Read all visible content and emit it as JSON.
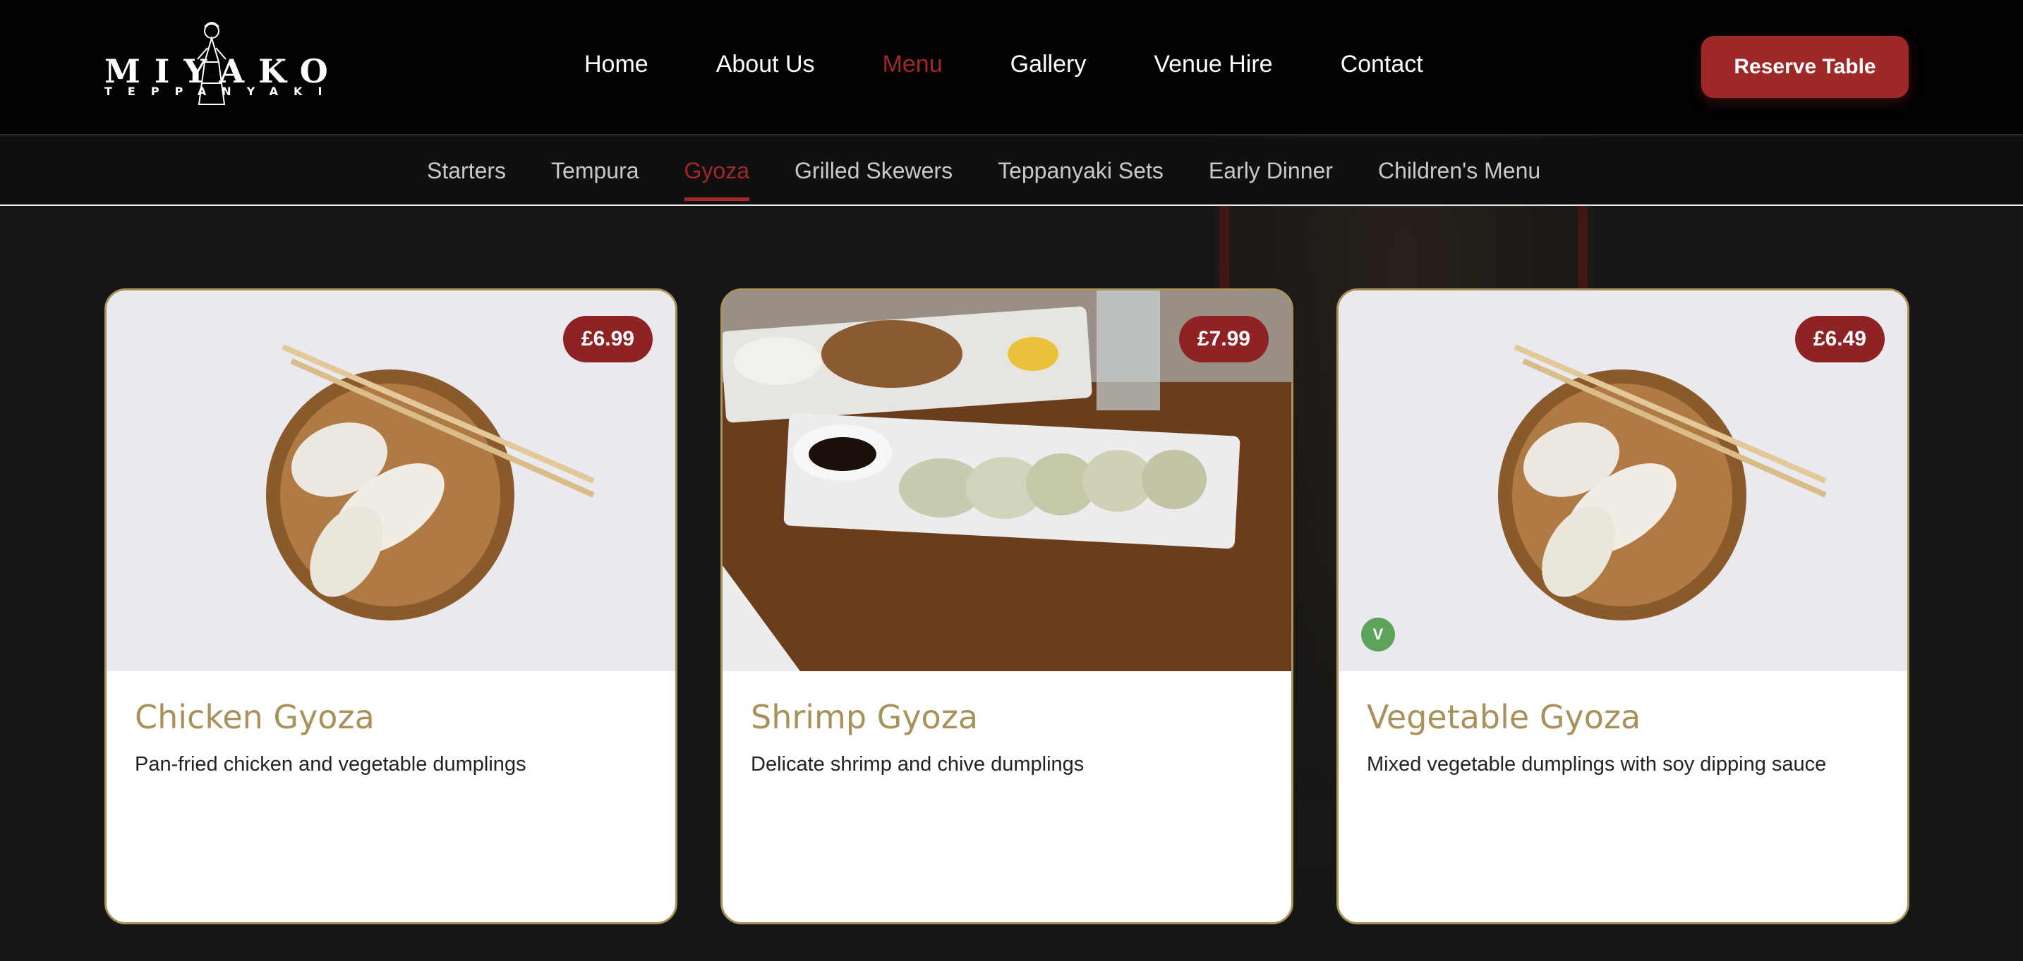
{
  "brand": {
    "name": "MIYAKO",
    "subtitle": "TEPPANYAKI"
  },
  "nav": {
    "items": [
      {
        "label": "Home",
        "active": false
      },
      {
        "label": "About Us",
        "active": false
      },
      {
        "label": "Menu",
        "active": true
      },
      {
        "label": "Gallery",
        "active": false
      },
      {
        "label": "Venue Hire",
        "active": false
      },
      {
        "label": "Contact",
        "active": false
      }
    ],
    "reserve_label": "Reserve Table"
  },
  "subnav": {
    "items": [
      {
        "label": "Starters",
        "active": false
      },
      {
        "label": "Tempura",
        "active": false
      },
      {
        "label": "Gyoza",
        "active": true
      },
      {
        "label": "Grilled Skewers",
        "active": false
      },
      {
        "label": "Teppanyaki Sets",
        "active": false
      },
      {
        "label": "Early Dinner",
        "active": false
      },
      {
        "label": "Children's Menu",
        "active": false
      }
    ]
  },
  "cards": [
    {
      "title": "Chicken Gyoza",
      "description": "Pan-fried chicken and vegetable dumplings",
      "price": "£6.99",
      "vegetarian": false
    },
    {
      "title": "Shrimp Gyoza",
      "description": "Delicate shrimp and chive dumplings",
      "price": "£7.99",
      "vegetarian": false
    },
    {
      "title": "Vegetable Gyoza",
      "description": "Mixed vegetable dumplings with soy dipping sauce",
      "price": "£6.49",
      "vegetarian": true,
      "veg_label": "V"
    }
  ],
  "colors": {
    "accent": "#9e2727",
    "gold": "#a8925a",
    "background": "#161616",
    "veg_badge": "#5ea35b"
  }
}
